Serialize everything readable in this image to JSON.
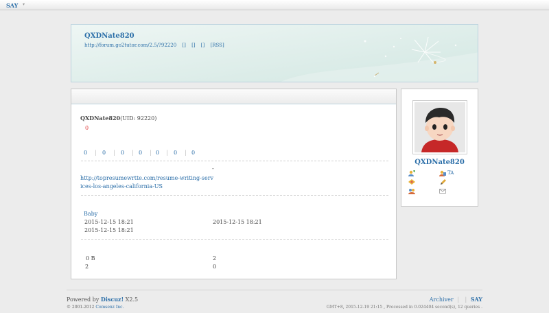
{
  "topbar": {
    "brand": "SAY",
    "caret": "▾"
  },
  "banner": {
    "username": "QXDNate820",
    "space_url": "http://forum.go2tutor.com/2.5/?92220",
    "link_a": "[]",
    "link_b": "[]",
    "link_c": "[]",
    "rss": "[RSS]"
  },
  "profile": {
    "name": "QXDNate820",
    "uid": "(UID: 92220)",
    "credit": "0",
    "stats": [
      "0",
      "0",
      "0",
      "0",
      "0",
      "0",
      "0"
    ],
    "dash_char": "-",
    "homepage": "http://topresumewrtte.com/resume-writing-services-los-angeles-california-US",
    "group": "Baby",
    "reg_time": "2015-12-15 18:21",
    "last_visit": "2015-12-15 18:21",
    "last_active": "2015-12-15 18:21",
    "attach_size": "0 B",
    "val_a": "2",
    "val_b": "2",
    "val_c": "0"
  },
  "sidebar": {
    "name": "QXDNate820",
    "ta_label": "TA"
  },
  "footer": {
    "powered": "Powered by",
    "discuz": "Discuz!",
    "version": "X2.5",
    "copyright": "© 2001-2012",
    "company": "Comsenz Inc.",
    "archiver": "Archiver",
    "sep1": "|",
    "sep2": "|",
    "say": "SAY",
    "timing": "GMT+8, 2015-12-19 21:15 , Processed in 0.024404 second(s), 12 queries ."
  },
  "colors": {
    "link": "#2b6ea8",
    "accent_red": "#e04040",
    "banner_bg": "#dcece8"
  }
}
